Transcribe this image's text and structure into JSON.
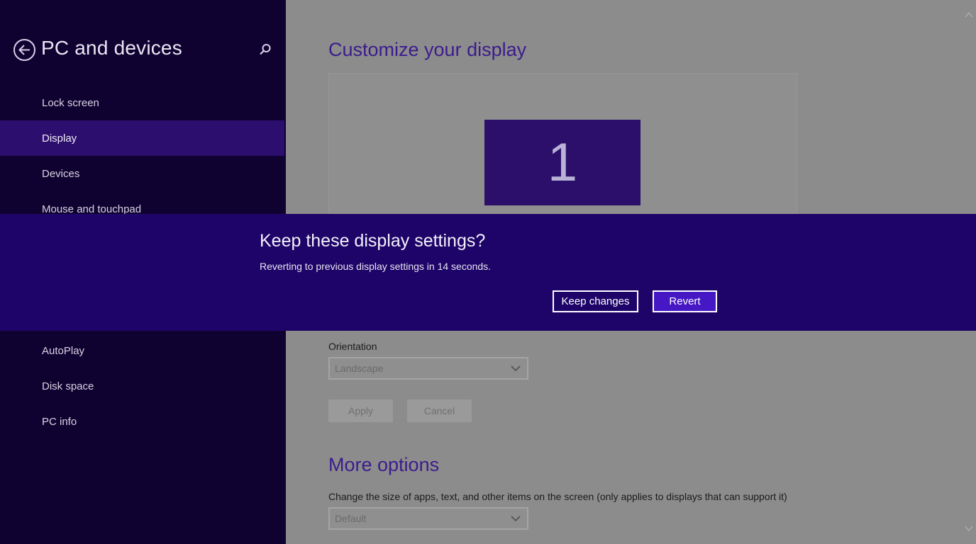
{
  "sidebar": {
    "title": "PC and devices",
    "items": [
      {
        "label": "Lock screen"
      },
      {
        "label": "Display"
      },
      {
        "label": "Devices"
      },
      {
        "label": "Mouse and touchpad"
      },
      {
        "label": "AutoPlay"
      },
      {
        "label": "Disk space"
      },
      {
        "label": "PC info"
      }
    ],
    "selected": "Display"
  },
  "main": {
    "customize_title": "Customize your display",
    "monitor_number": "1",
    "orientation": {
      "label": "Orientation",
      "value": "Landscape"
    },
    "apply_label": "Apply",
    "cancel_label": "Cancel",
    "more_options_title": "More options",
    "size": {
      "label": "Change the size of apps, text, and other items on the screen (only applies to displays that can support it)",
      "value": "Default"
    }
  },
  "dialog": {
    "title": "Keep these display settings?",
    "message": "Reverting to previous display settings in 14 seconds.",
    "keep_label": "Keep changes",
    "revert_label": "Revert"
  },
  "colors": {
    "sidebar_bg": "#0f0231",
    "selected_item_bg": "#2c0e6e",
    "dialog_bg": "#1e0469",
    "revert_button_bg": "#4617c4",
    "heading_color": "#3b1c8e"
  },
  "icons": {
    "back": "back-arrow-icon",
    "search": "search-icon",
    "dropdown": "chevron-down-icon",
    "scroll_up": "scroll-up-icon",
    "scroll_down": "scroll-down-icon"
  }
}
